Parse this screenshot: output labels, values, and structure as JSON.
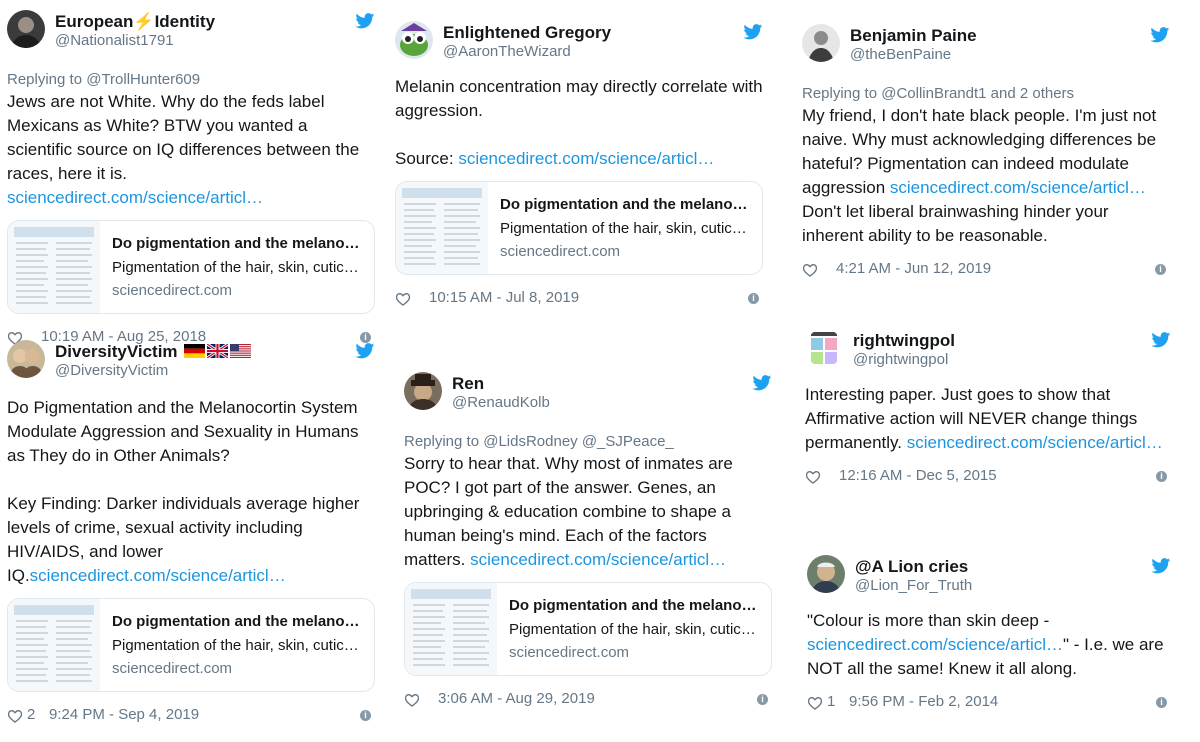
{
  "colors": {
    "link": "#1b95e0",
    "muted": "#657786",
    "twitter_blue": "#1da1f2"
  },
  "t1": {
    "name_a": "European",
    "name_bolt": "⚡",
    "name_b": "Identity",
    "handle": "@Nationalist1791",
    "reply": "Replying to @TrollHunter609",
    "text": "Jews are not White. Why do the feds label Mexicans as White? BTW you wanted a scientific source on IQ differences between the races, here it is.",
    "link": "sciencedirect.com/science/articl…",
    "card": {
      "title": "Do pigmentation and the melano…",
      "desc": "Pigmentation of the hair, skin, cuticl…",
      "url": "sciencedirect.com"
    },
    "time": "10:19 AM - Aug 25, 2018"
  },
  "t2": {
    "name": "DiversityVictim",
    "flags": [
      "germany-flag",
      "uk-flag",
      "usa-flag"
    ],
    "handle": "@DiversityVictim",
    "text1": "Do Pigmentation and the Melanocortin System Modulate Aggression and Sexuality in Humans as They do in Other Animals?",
    "text2": "Key Finding: Darker individuals average higher levels of crime, sexual activity including HIV/AIDS, and lower IQ.",
    "link": "sciencedirect.com/science/articl…",
    "card": {
      "title": "Do pigmentation and the melano…",
      "desc": "Pigmentation of the hair, skin, cuticl…",
      "url": "sciencedirect.com"
    },
    "likes": "2",
    "time": "9:24 PM - Sep 4, 2019"
  },
  "t3": {
    "name": "Enlightened Gregory",
    "handle": "@AaronTheWizard",
    "text": "Melanin concentration may directly correlate with aggression.",
    "source_label": "Source:",
    "link": "sciencedirect.com/science/articl…",
    "card": {
      "title": "Do pigmentation and the melano…",
      "desc": "Pigmentation of the hair, skin, cuticl…",
      "url": "sciencedirect.com"
    },
    "time": "10:15 AM - Jul 8, 2019"
  },
  "t4": {
    "name": "Ren",
    "handle": "@RenaudKolb",
    "reply": "Replying to @LidsRodney @_SJPeace_",
    "text": "Sorry to hear that. Why most of inmates are POC? I got part of the answer. Genes, an upbringing & education combine to shape a human being's mind. Each of the factors matters.",
    "link": "sciencedirect.com/science/articl…",
    "card": {
      "title": "Do pigmentation and the melano…",
      "desc": "Pigmentation of the hair, skin, cuticl…",
      "url": "sciencedirect.com"
    },
    "time": "3:06 AM - Aug 29, 2019"
  },
  "t5": {
    "name": "Benjamin Paine",
    "handle": "@theBenPaine",
    "reply": "Replying to @CollinBrandt1 and 2 others",
    "text_a": "My friend, I don't hate black people. I'm just not naive. Why must acknowledging differences be hateful? Pigmentation can indeed modulate aggression",
    "link": "sciencedirect.com/science/articl…",
    "text_b": "Don't let liberal brainwashing hinder your inherent ability to be reasonable.",
    "time": "4:21 AM - Jun 12, 2019"
  },
  "t6": {
    "name": "rightwingpol",
    "handle": "@rightwingpol",
    "text": "Interesting paper. Just goes to show that Affirmative action will NEVER change things permanently.",
    "link": "sciencedirect.com/science/articl…",
    "time": "12:16 AM - Dec 5, 2015"
  },
  "t7": {
    "name": "@A Lion cries",
    "handle": "@Lion_For_Truth",
    "text_a": "\"Colour is more than skin deep -",
    "link": "sciencedirect.com/science/articl…",
    "text_b": "\" - I.e. we are NOT all the same! Knew it all along.",
    "likes": "1",
    "time": "9:56 PM - Feb 2, 2014"
  }
}
